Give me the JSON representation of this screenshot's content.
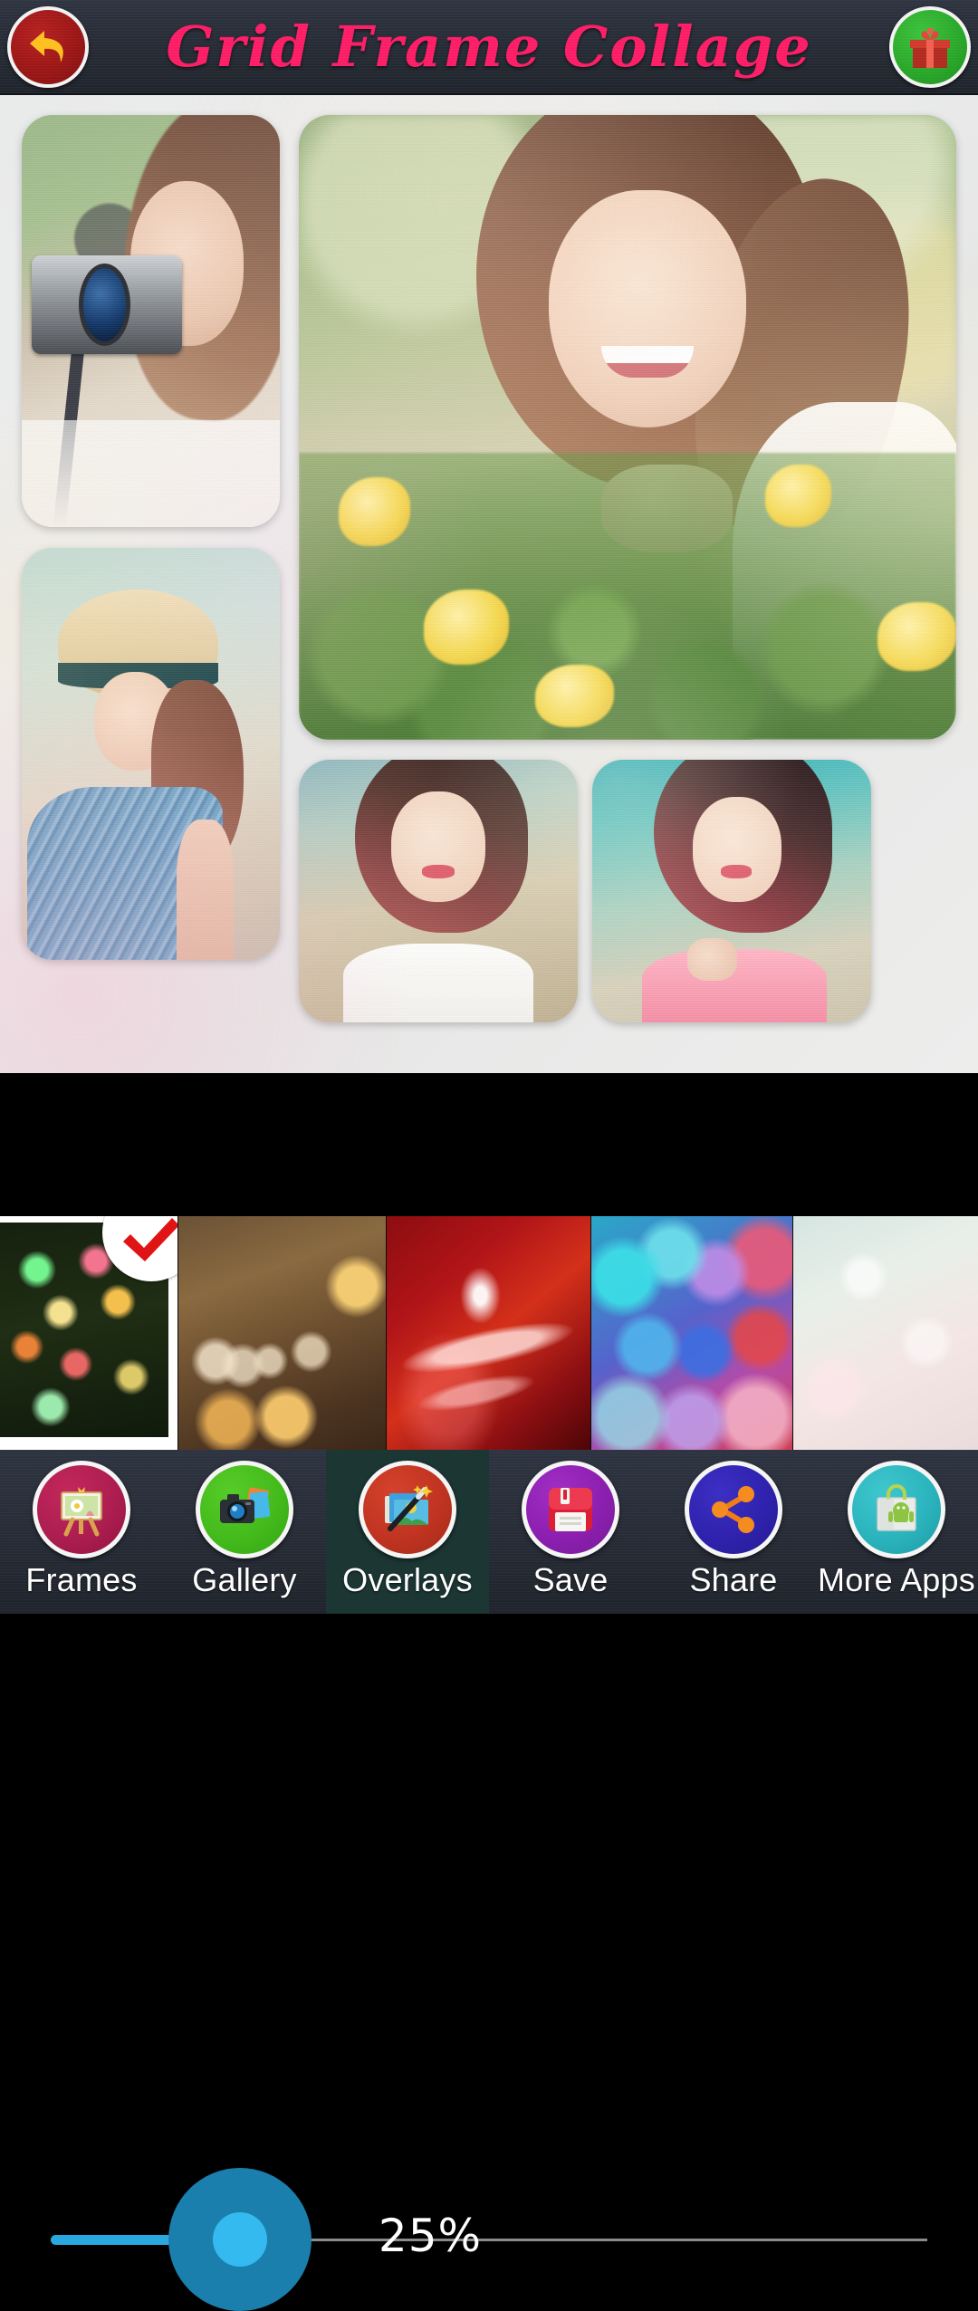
{
  "header": {
    "title": "Grid Frame Collage",
    "back_icon": "back-arrow-icon",
    "gift_icon": "gift-icon",
    "bg_color": "#272c36",
    "title_color": "#fc1d66"
  },
  "collage": {
    "background_color": "#eceded",
    "photos": [
      {
        "id": "photo-1",
        "caption": "girl holding a camera"
      },
      {
        "id": "photo-2",
        "caption": "girl smiling among yellow flowers"
      },
      {
        "id": "photo-3",
        "caption": "girl wearing straw hat"
      },
      {
        "id": "photo-4",
        "caption": "girl in white top"
      },
      {
        "id": "photo-5",
        "caption": "girl in pink top"
      }
    ]
  },
  "slider": {
    "value_label": "25%",
    "value": 25,
    "min": 0,
    "max": 100,
    "fill_color": "#29a8e0",
    "thumb_color": "#35baf0",
    "track_color": "#8b8b8b"
  },
  "overlays": {
    "selected_index": 0,
    "check_color": "#e01414",
    "thumbnails": [
      {
        "name": "butterfly-lights-overlay",
        "selected": true
      },
      {
        "name": "golden-bokeh-overlay",
        "selected": false
      },
      {
        "name": "red-swirl-overlay",
        "selected": false
      },
      {
        "name": "colorful-hearts-bokeh-overlay",
        "selected": false
      },
      {
        "name": "pale-mint-bokeh-overlay",
        "selected": false
      }
    ]
  },
  "bottom_nav": {
    "active_index": 2,
    "items": [
      {
        "label": "Frames",
        "icon": "easel-picture-icon",
        "color": "#ad1e50"
      },
      {
        "label": "Gallery",
        "icon": "camera-photos-icon",
        "color": "#44bb1c"
      },
      {
        "label": "Overlays",
        "icon": "magic-wand-photo-icon",
        "color": "#c03421"
      },
      {
        "label": "Save",
        "icon": "floppy-disk-icon",
        "color": "#8c1fb0"
      },
      {
        "label": "Share",
        "icon": "share-nodes-icon",
        "color": "#2f22ae"
      },
      {
        "label": "More Apps",
        "icon": "shopping-bag-android-icon",
        "color": "#2bb4bd"
      }
    ]
  }
}
